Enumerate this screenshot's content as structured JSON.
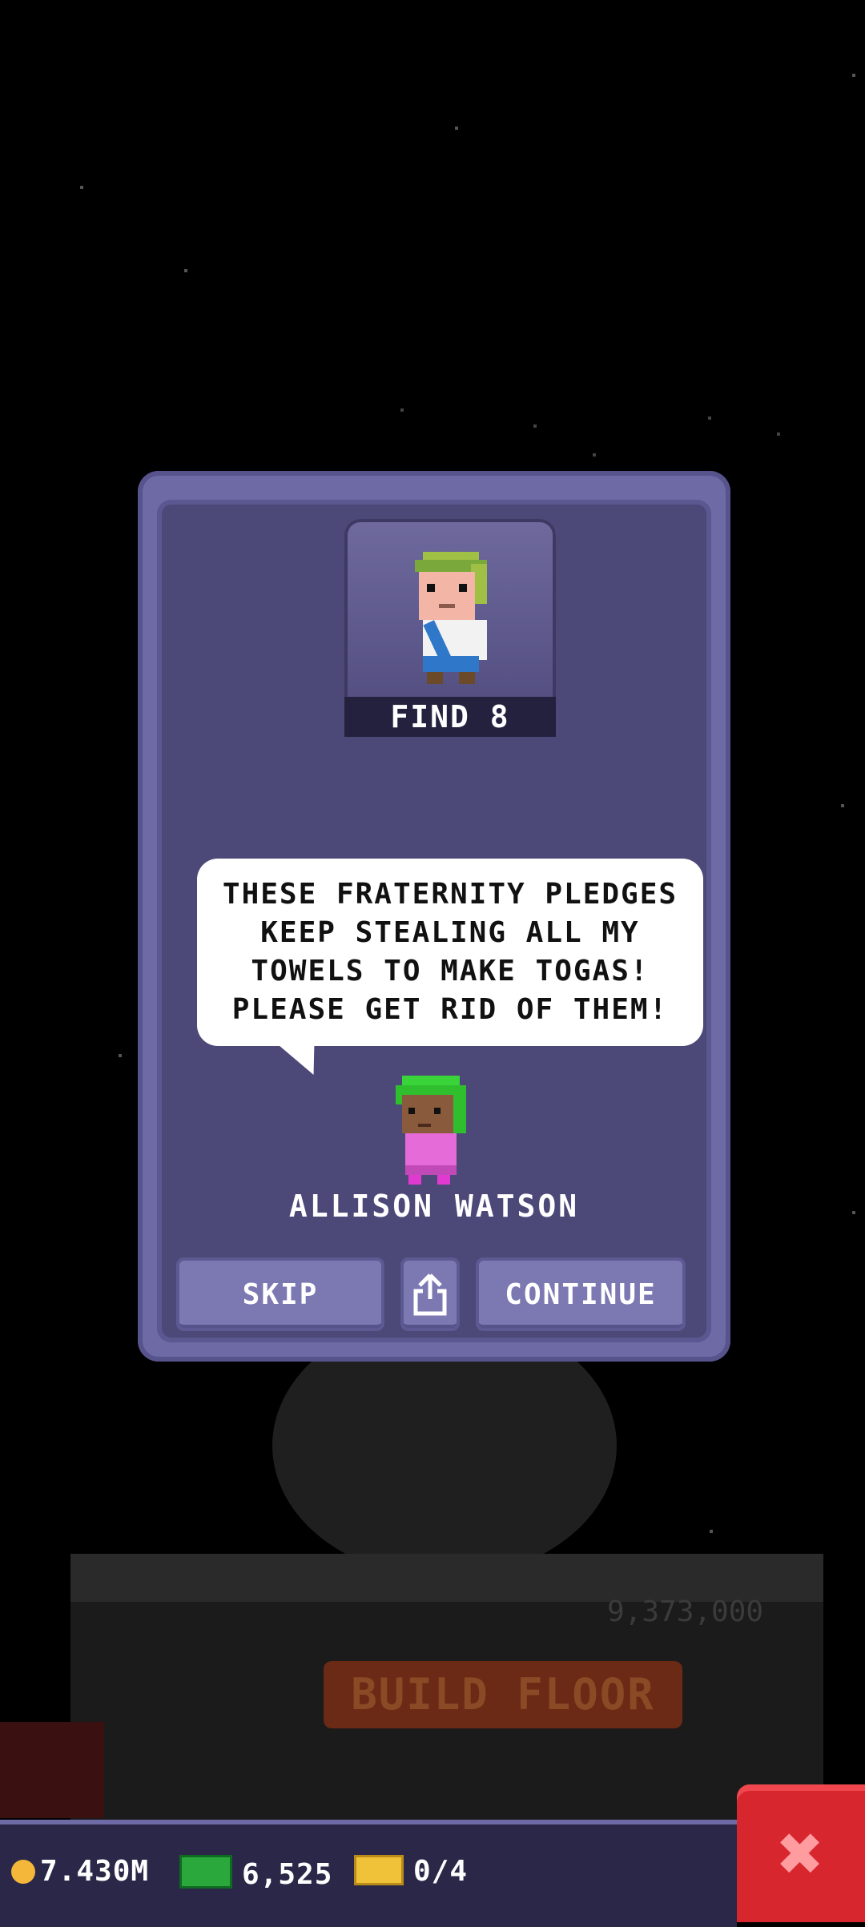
{
  "modal": {
    "quest_label": "FIND 8",
    "message_lines": [
      "THESE FRATERNITY PLEDGES",
      "KEEP STEALING ALL MY",
      "TOWELS TO MAKE TOGAS!",
      "PLEASE GET RID OF THEM!"
    ],
    "speaker_name": "ALLISON WATSON",
    "skip_label": "SKIP",
    "share_icon": "share-icon",
    "continue_label": "CONTINUE"
  },
  "background": {
    "floor_cost": "9,373,000",
    "build_floor_label": "BUILD FLOOR"
  },
  "status_bar": {
    "coins": "7.430M",
    "bux": "6,525",
    "tickets": "0/4"
  },
  "close_icon": "close-icon",
  "colors": {
    "panel": "#6e6aa6",
    "panel_inner": "#4c4878",
    "close_button": "#d8262e"
  }
}
